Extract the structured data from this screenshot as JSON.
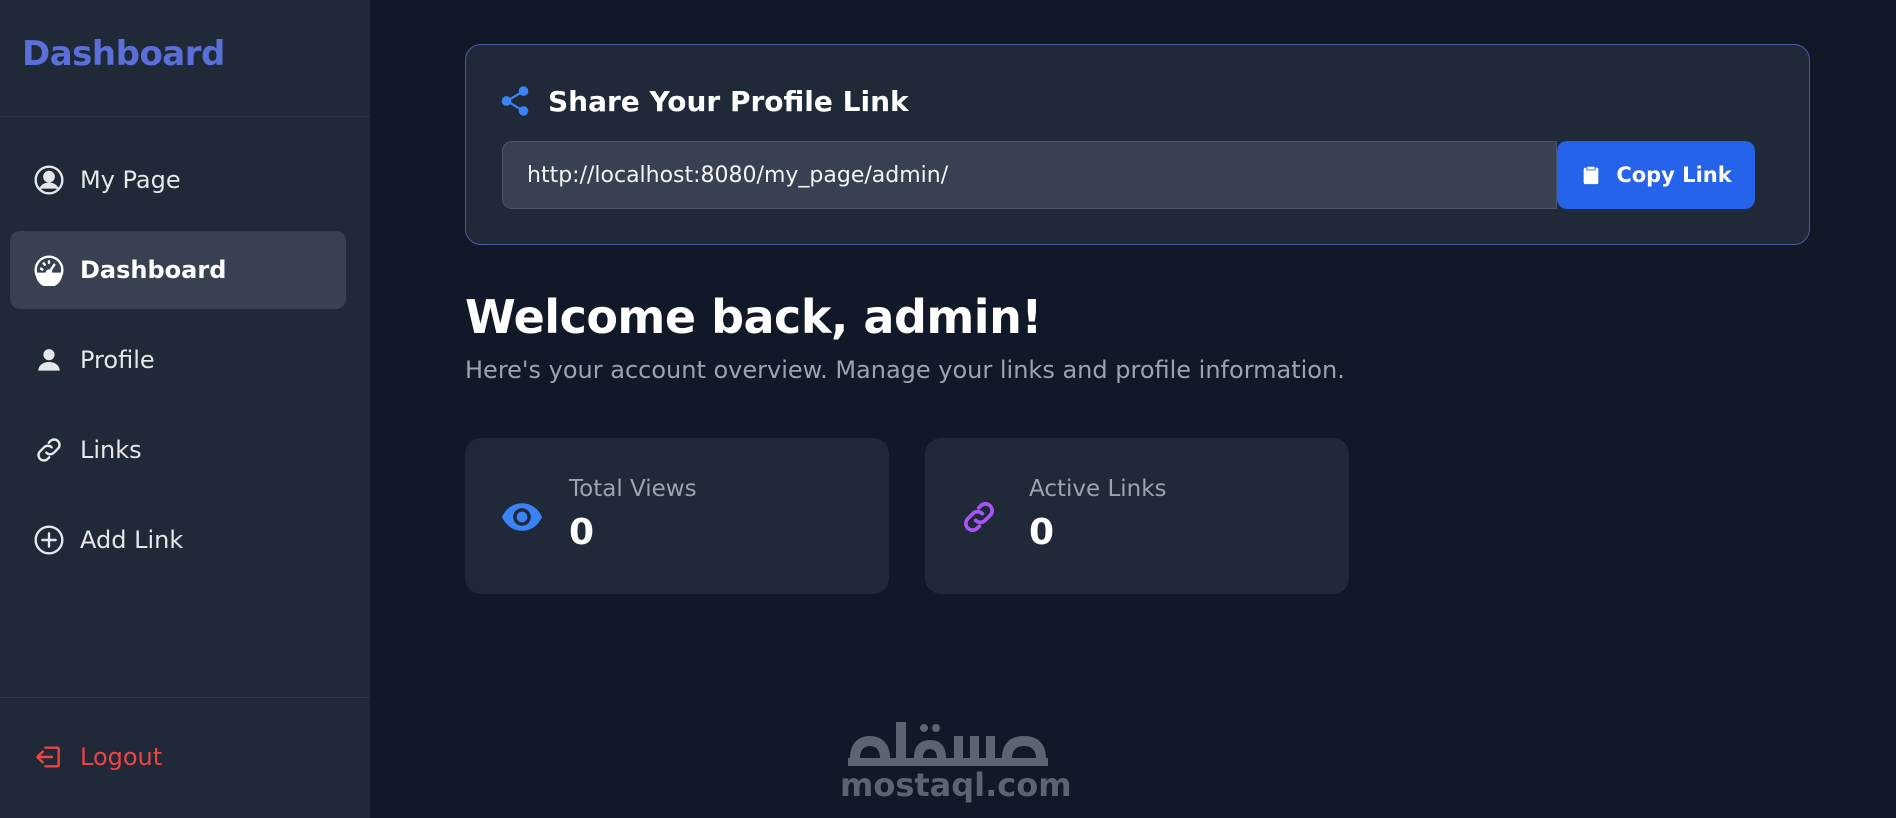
{
  "sidebar": {
    "brand": "Dashboard",
    "items": [
      {
        "label": "My Page",
        "icon": "user-circle-icon",
        "active": false
      },
      {
        "label": "Dashboard",
        "icon": "speedometer-icon",
        "active": true
      },
      {
        "label": "Profile",
        "icon": "user-icon",
        "active": false
      },
      {
        "label": "Links",
        "icon": "link-icon",
        "active": false
      },
      {
        "label": "Add Link",
        "icon": "plus-circle-icon",
        "active": false
      }
    ],
    "logout_label": "Logout"
  },
  "share": {
    "title": "Share Your Profile Link",
    "link_value": "http://localhost:8080/my_page/admin/",
    "copy_label": "Copy Link"
  },
  "welcome": {
    "title": "Welcome back, admin!",
    "subtitle": "Here's your account overview. Manage your links and profile information."
  },
  "stats": [
    {
      "label": "Total Views",
      "value": "0",
      "icon": "eye-icon",
      "color": "#3b82f6"
    },
    {
      "label": "Active Links",
      "value": "0",
      "icon": "link-icon",
      "color": "#a855f7"
    }
  ],
  "watermark": {
    "arabic": "مستقل",
    "latin": "mostaql.com"
  },
  "colors": {
    "background": "#111827",
    "sidebar": "#1f2937",
    "brand": "#5b6fd8",
    "accent": "#2563eb",
    "danger": "#ef4444"
  }
}
